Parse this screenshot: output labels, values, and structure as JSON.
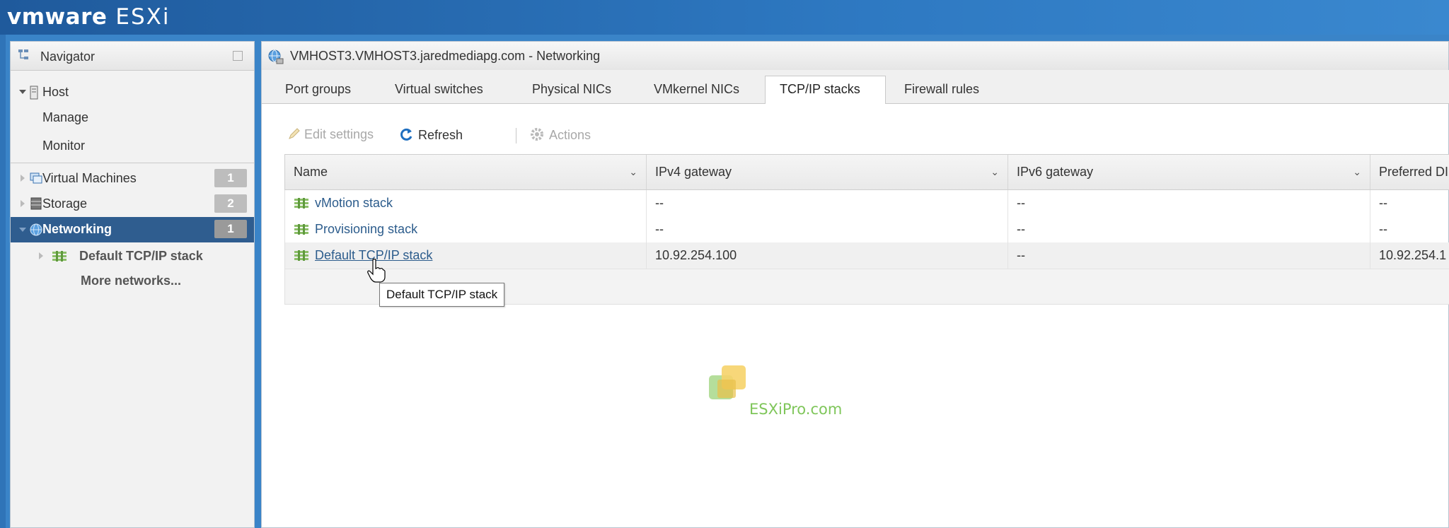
{
  "brand": {
    "vm": "vmware",
    "product": "ESXi"
  },
  "navigator": {
    "title": "Navigator",
    "host": {
      "label": "Host",
      "children": [
        "Manage",
        "Monitor"
      ]
    },
    "items": [
      {
        "label": "Virtual Machines",
        "badge": "1"
      },
      {
        "label": "Storage",
        "badge": "2"
      },
      {
        "label": "Networking",
        "badge": "1"
      }
    ],
    "networking_children": {
      "stack": "Default TCP/IP stack",
      "more": "More networks..."
    }
  },
  "main": {
    "title": "VMHOST3.VMHOST3.jaredmediapg.com - Networking",
    "tabs": [
      "Port groups",
      "Virtual switches",
      "Physical NICs",
      "VMkernel NICs",
      "TCP/IP stacks",
      "Firewall rules"
    ],
    "active_tab": "TCP/IP stacks",
    "toolbar": {
      "edit": "Edit settings",
      "refresh": "Refresh",
      "actions": "Actions"
    },
    "columns": [
      "Name",
      "IPv4 gateway",
      "IPv6 gateway",
      "Preferred DI"
    ],
    "rows": [
      {
        "name": "vMotion stack",
        "ipv4": "--",
        "ipv6": "--",
        "dns": "--"
      },
      {
        "name": "Provisioning stack",
        "ipv4": "--",
        "ipv6": "--",
        "dns": "--"
      },
      {
        "name": "Default TCP/IP stack",
        "ipv4": "10.92.254.100",
        "ipv6": "--",
        "dns": "10.92.254.1"
      }
    ],
    "tooltip": "Default TCP/IP stack"
  },
  "watermark": "ESXiPro.com",
  "colors": {
    "accent": "#2f5d8f",
    "link": "#2c5c8c",
    "topbar": "#2e79c2"
  }
}
